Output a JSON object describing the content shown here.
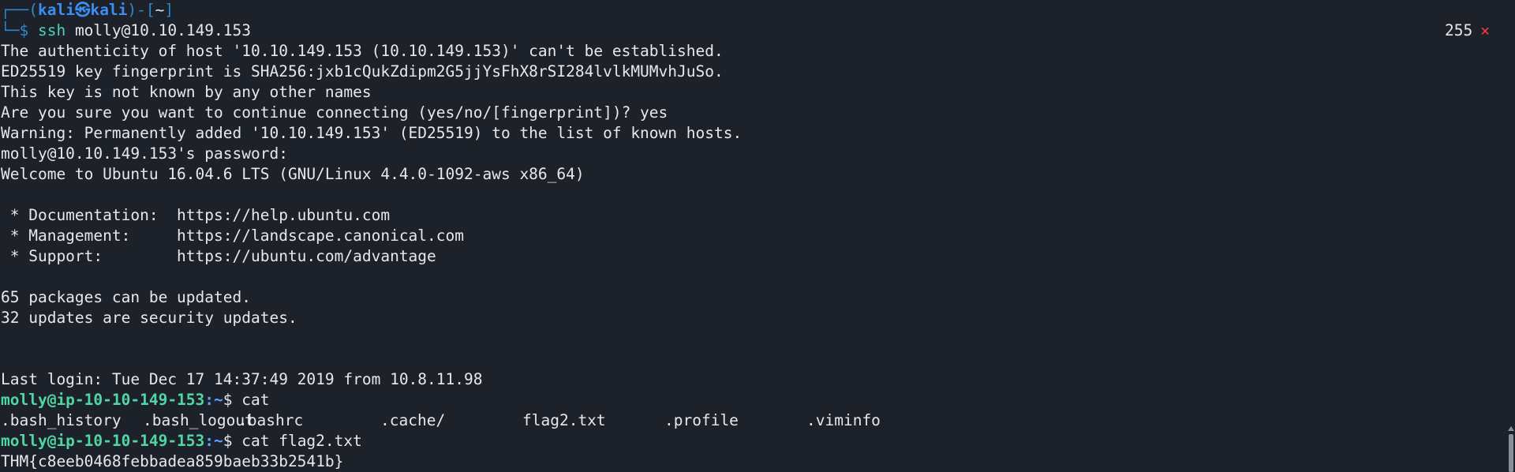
{
  "prompt_header": {
    "frame_left": "┌──(",
    "user": "kali",
    "skull": "㉿",
    "host": "kali",
    "frame_right": ")-[",
    "dir": "~",
    "frame_close": "]"
  },
  "prompt_line": {
    "frame": "└─$ ",
    "cmd": "ssh",
    "args": " molly@10.10.149.153"
  },
  "status": {
    "exit_code": "255",
    "error_mark": "✕"
  },
  "output": [
    "The authenticity of host '10.10.149.153 (10.10.149.153)' can't be established.",
    "ED25519 key fingerprint is SHA256:jxb1cQukZdipm2G5jjYsFhX8rSI284lvlkMUMvhJuSo.",
    "This key is not known by any other names",
    "Are you sure you want to continue connecting (yes/no/[fingerprint])? yes",
    "Warning: Permanently added '10.10.149.153' (ED25519) to the list of known hosts.",
    "molly@10.10.149.153's password: ",
    "Welcome to Ubuntu 16.04.6 LTS (GNU/Linux 4.4.0-1092-aws x86_64)",
    "",
    " * Documentation:  https://help.ubuntu.com",
    " * Management:     https://landscape.canonical.com",
    " * Support:        https://ubuntu.com/advantage",
    "",
    "65 packages can be updated.",
    "32 updates are security updates.",
    "",
    "",
    "Last login: Tue Dec 17 14:37:49 2019 from 10.8.11.98"
  ],
  "remote_prompt_1": {
    "user_host": "molly@ip-10-10-149-153",
    "path": ":~",
    "symbol": "$ ",
    "cmd": "cat"
  },
  "ls_files": [
    ".bash_history",
    ".bash_logout",
    ".bashrc",
    ".cache/",
    "flag2.txt",
    ".profile",
    ".viminfo"
  ],
  "remote_prompt_2": {
    "user_host": "molly@ip-10-10-149-153",
    "path": ":~",
    "symbol": "$ ",
    "cmd": "cat flag2.txt"
  },
  "flag_output": "THM{c8eeb0468febbadea859baeb33b2541b}"
}
